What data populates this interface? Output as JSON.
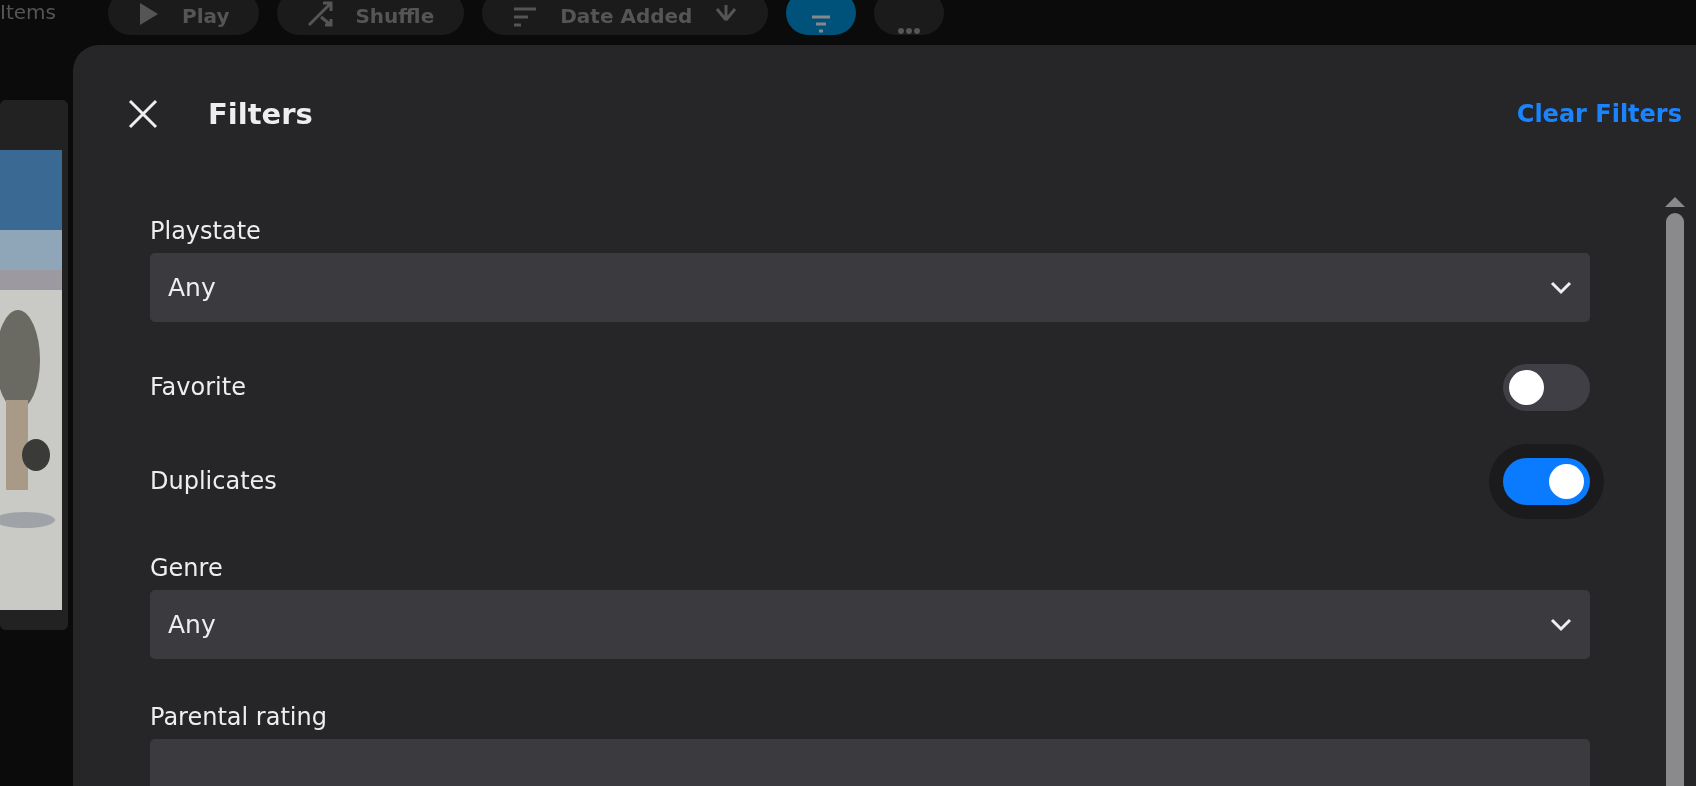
{
  "top_bar": {
    "item_count": "Items",
    "buttons": [
      {
        "kind": "play",
        "label": "Play"
      },
      {
        "kind": "shuffle",
        "label": "Shuffle"
      },
      {
        "kind": "sort",
        "label": "Date Added"
      },
      {
        "kind": "filter",
        "selected": true
      },
      {
        "kind": "more",
        "selected": false
      }
    ]
  },
  "dialog": {
    "title": "Filters",
    "clear_link": "Clear Filters",
    "fields": [
      {
        "kind": "select",
        "label": "Playstate",
        "value": "Any"
      },
      {
        "kind": "toggle",
        "label": "Favorite",
        "on": false
      },
      {
        "kind": "toggle",
        "label": "Duplicates",
        "on": true
      },
      {
        "kind": "select",
        "label": "Genre",
        "value": "Any"
      },
      {
        "kind": "select",
        "label": "Parental rating"
      }
    ]
  }
}
